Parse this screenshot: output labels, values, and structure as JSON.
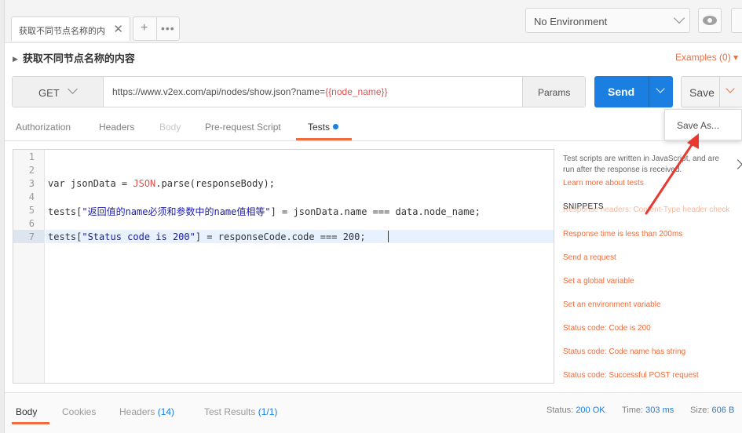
{
  "tabs": {
    "active_label": "获取不同节点名称的内",
    "close_glyph": "✕",
    "new_tab_glyph": "+",
    "more_glyph": "•••"
  },
  "environment": {
    "selected": "No Environment"
  },
  "request": {
    "name": "获取不同节点名称的内容",
    "examples_label": "Examples (0)",
    "method": "GET",
    "url_prefix": "https://www.v2ex.com/api/nodes/show.json?name=",
    "url_variable": "{{node_name}}",
    "params_label": "Params",
    "send_label": "Send",
    "save_label": "Save",
    "save_as_label": "Save As..."
  },
  "request_tabs": [
    {
      "label": "Authorization",
      "state": "normal"
    },
    {
      "label": "Headers",
      "state": "normal"
    },
    {
      "label": "Body",
      "state": "disabled"
    },
    {
      "label": "Pre-request Script",
      "state": "normal"
    },
    {
      "label": "Tests",
      "state": "active"
    }
  ],
  "editor": {
    "line_numbers": [
      "1",
      "2",
      "3",
      "4",
      "5",
      "6",
      "7"
    ],
    "lines": {
      "l3_var": "var jsonData = ",
      "l3_obj": "JSON",
      "l3_rest": ".parse(responseBody);",
      "l5_a": "tests[",
      "l5_str": "\"返回值的name必须和参数中的name值相等\"",
      "l5_b": "] = jsonData.name === data.node_name;",
      "l7_a": "tests[",
      "l7_str": "\"Status code is 200\"",
      "l7_b": "] = responseCode.code === 200;"
    }
  },
  "snippets": {
    "description": "Test scripts are written in JavaScript, and are run after the response is received.",
    "learn_more": "Learn more about tests",
    "heading": "SNIPPETS",
    "items": [
      "Response headers: Content-Type header check",
      "Response time is less than 200ms",
      "Send a request",
      "Set a global variable",
      "Set an environment variable",
      "Status code: Code is 200",
      "Status code: Code name has string",
      "Status code: Successful POST request"
    ]
  },
  "response": {
    "tabs": {
      "body": "Body",
      "cookies": "Cookies",
      "headers": "Headers",
      "headers_count": "(14)",
      "test_results": "Test Results",
      "test_results_count": "(1/1)"
    },
    "status_label": "Status:",
    "status_value": "200 OK",
    "time_label": "Time:",
    "time_value": "303 ms",
    "size_label": "Size:",
    "size_value": "606 B"
  },
  "colors": {
    "accent": "#f26b3a",
    "primary": "#1a7fe0",
    "annotation_arrow": "#e8382f"
  },
  "icons": [
    "close-icon",
    "plus-icon",
    "more-icon",
    "chevron-down-icon",
    "eye-icon",
    "chevron-right-icon",
    "annotation-arrow-icon"
  ]
}
